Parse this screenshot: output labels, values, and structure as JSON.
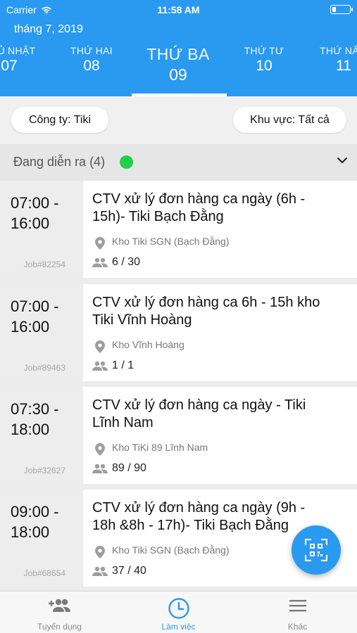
{
  "status_bar": {
    "carrier": "Carrier",
    "time": "11:58 AM",
    "battery_level": 0.2
  },
  "header": {
    "month": "tháng 7,  2019",
    "days": [
      {
        "name": "CHỦ NHẬT",
        "num": "07"
      },
      {
        "name": "THỨ HAI",
        "num": "08"
      },
      {
        "name": "THỨ BA",
        "num": "09",
        "active": true
      },
      {
        "name": "THỨ TƯ",
        "num": "10"
      },
      {
        "name": "THỨ NĂM",
        "num": "11"
      }
    ]
  },
  "filters": {
    "company": "Công ty: Tiki",
    "region": "Khu vực: Tất cả"
  },
  "section": {
    "title": "Đang diễn ra (4)",
    "status_color": "#22d04a"
  },
  "jobs": [
    {
      "time": "07:00 - 16:00",
      "job_id": "Job#82254",
      "title_line1": "CTV xử lý đơn hàng ca ngày (6h -",
      "title_line2": "15h)- Tiki Bạch Đằng",
      "location": "Kho Tiki SGN (Bạch Đằng)",
      "count": "6 / 30"
    },
    {
      "time": "07:00 - 16:00",
      "job_id": "Job#89463",
      "title_line1": "CTV xử lý đơn hàng ca 6h - 15h kho",
      "title_line2": "Tiki Vĩnh Hoàng",
      "location": "Kho Vĩnh Hoàng",
      "count": "1 / 1"
    },
    {
      "time": "07:30 - 18:00",
      "job_id": "Job#32627",
      "title_line1": "CTV xử lý đơn hàng ca ngày - Tiki",
      "title_line2": "Lĩnh Nam",
      "location": "Kho TiKi 89 Lĩnh Nam",
      "count": "89 / 90"
    },
    {
      "time": "09:00 - 18:00",
      "job_id": "Job#68654",
      "title_line1": "CTV xử lý đơn hàng ca ngày (9h -",
      "title_line2": "18h &8h - 17h)- Tiki Bạch Đằng",
      "location": "Kho Tiki SGN (Bạch Đằng)",
      "count": "37 / 40"
    }
  ],
  "tabbar": {
    "items": [
      {
        "label": "Tuyển dụng",
        "icon": "add-people-icon"
      },
      {
        "label": "Làm việc",
        "icon": "clock-icon",
        "active": true
      },
      {
        "label": "Khác",
        "icon": "menu-icon"
      }
    ]
  },
  "fab": {
    "icon": "qr-scan-icon"
  },
  "colors": {
    "primary": "#2a9af0",
    "status_green": "#22d04a"
  }
}
